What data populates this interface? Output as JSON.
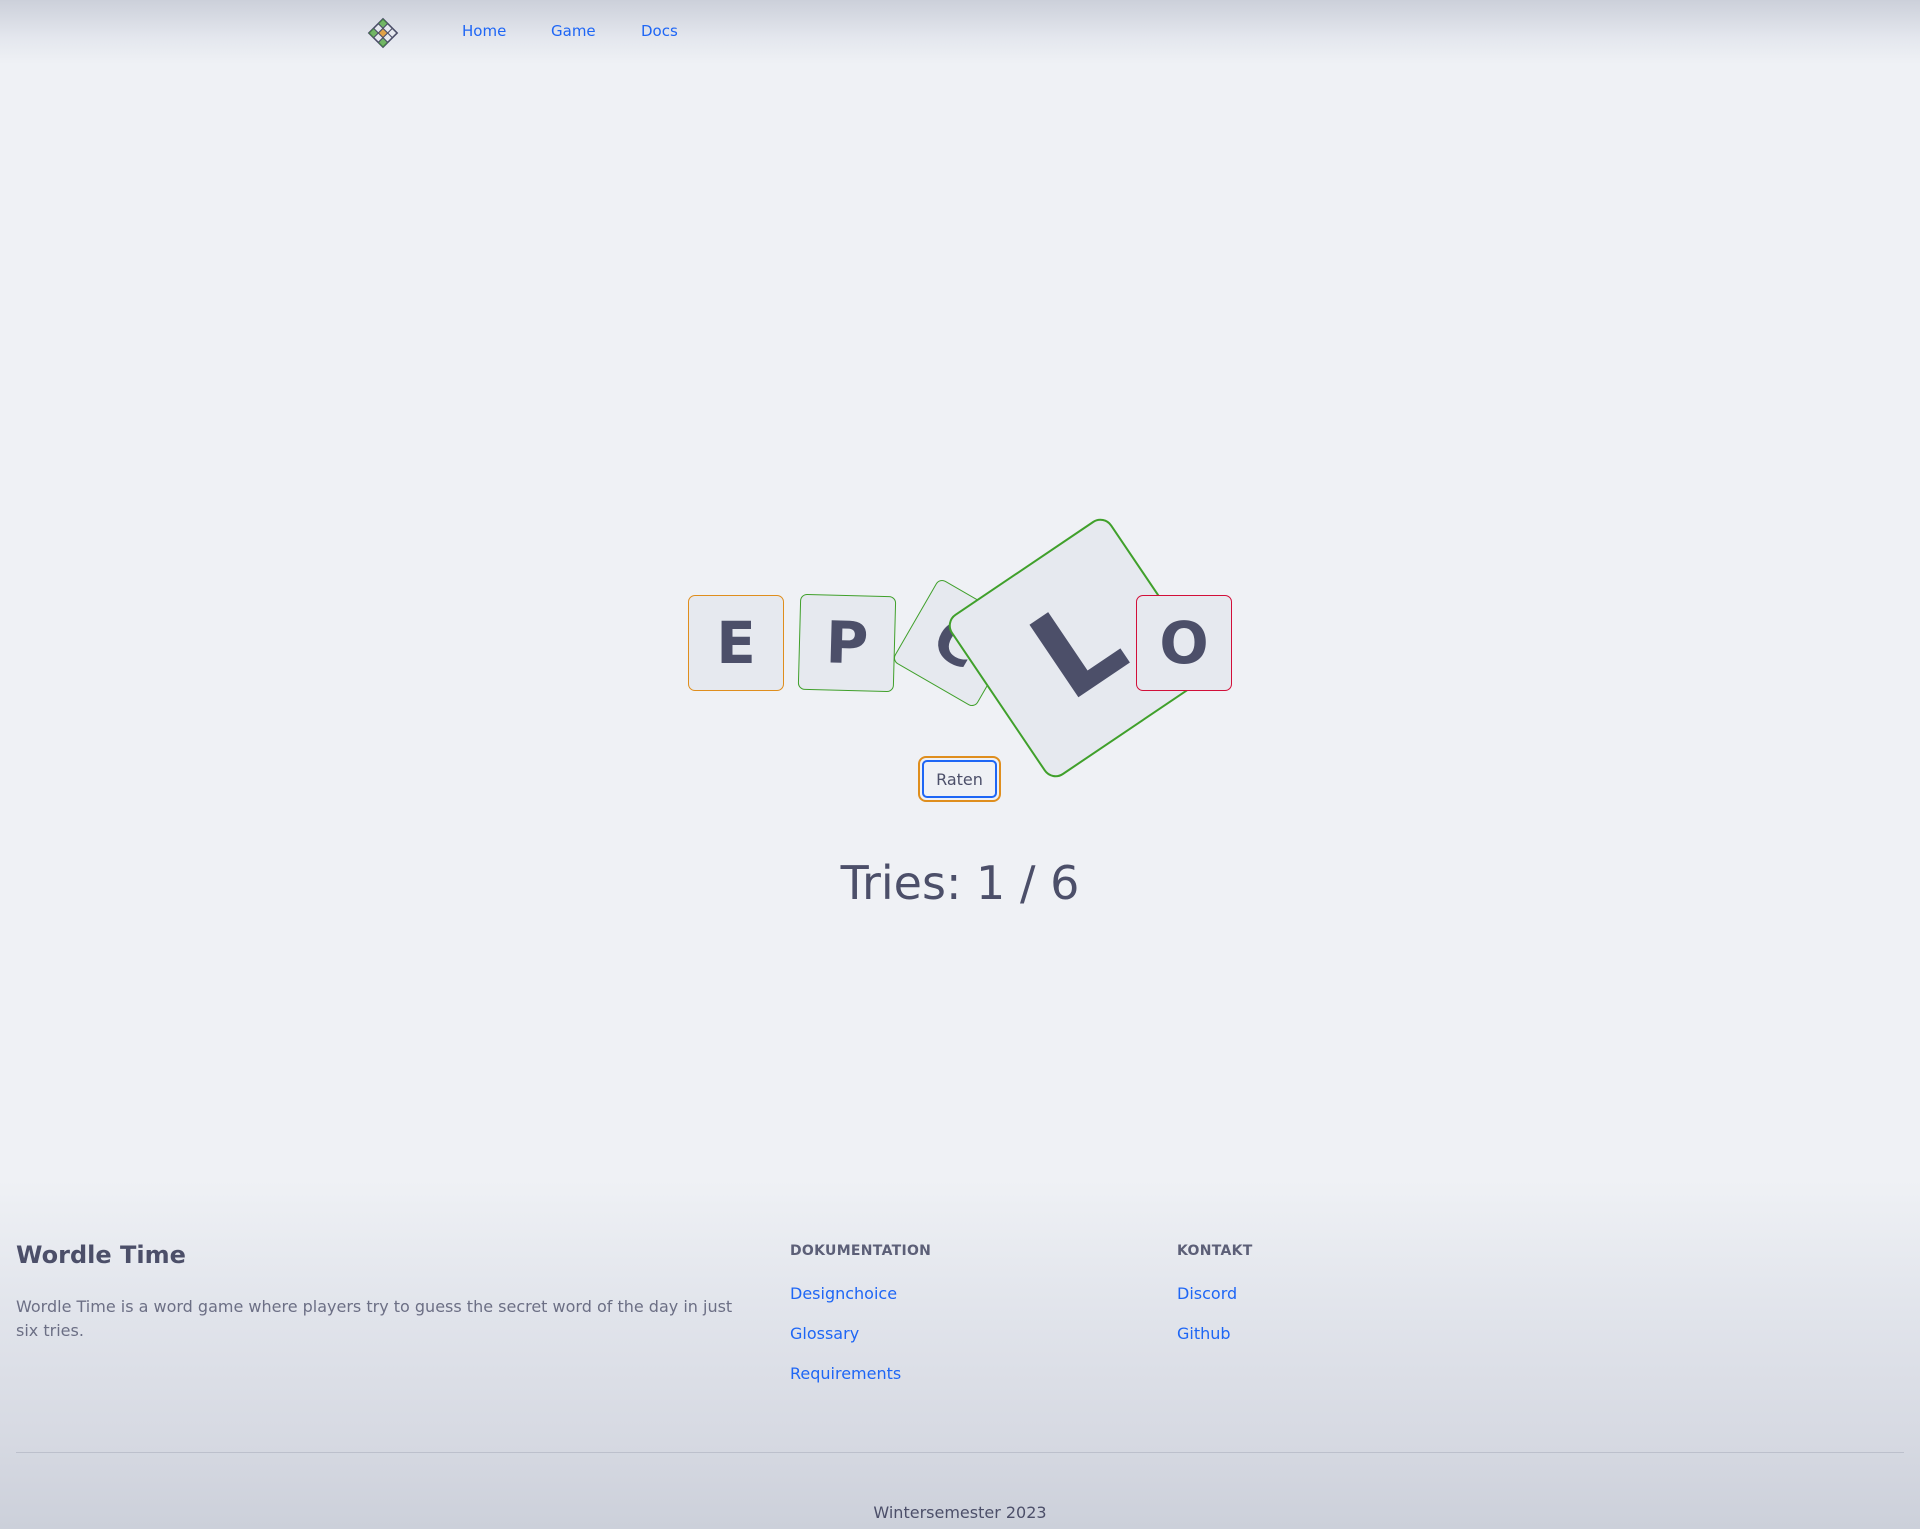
{
  "nav": {
    "logo": "wordle-logo",
    "links": [
      "Home",
      "Game",
      "Docs"
    ]
  },
  "game": {
    "tiles": [
      {
        "letter": "E",
        "status_color": "#df8e1d"
      },
      {
        "letter": "P",
        "status_color": "#40a02b"
      },
      {
        "letter": "C",
        "status_color": "#40a02b"
      },
      {
        "letter": "L",
        "status_color": "#40a02b"
      },
      {
        "letter": "O",
        "status_color": "#d20f39"
      }
    ],
    "guess_button": "Raten",
    "tries": "Tries: 1 / 6"
  },
  "footer": {
    "title": "Wordle Time",
    "description": "Wordle Time is a word game where players try to guess the secret word of the day in just six tries.",
    "docs_heading": "DOKUMENTATION",
    "docs_links": [
      "Designchoice",
      "Glossary",
      "Requirements"
    ],
    "contact_heading": "KONTAKT",
    "contact_links": [
      "Discord",
      "Github"
    ],
    "credit": "Wintersemester 2023"
  },
  "colors": {
    "accent": "#1e66f5",
    "text": "#4c4f69",
    "present": "#df8e1d",
    "correct": "#40a02b",
    "absent": "#d20f39",
    "tile_bg": "#e6e9ef"
  }
}
